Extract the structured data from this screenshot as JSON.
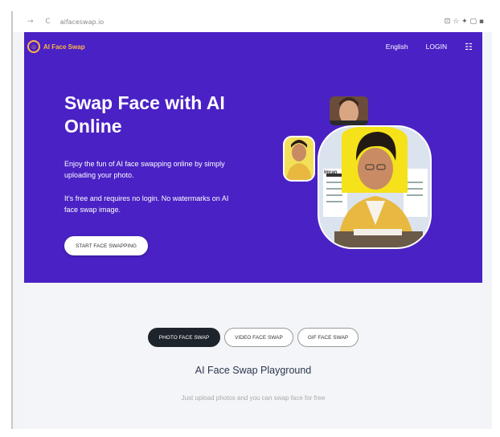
{
  "browser": {
    "nav_icons": "→ C",
    "url": "aifaceswap.io",
    "right_icons": "⊡ ☆ ✦ ▢ ▪"
  },
  "header": {
    "logo_text": "AI Face Swap",
    "language": "English",
    "login": "LOGIN",
    "menu_icon": "menu-icon"
  },
  "hero": {
    "title": "Swap Face with AI Online",
    "description_1": "Enjoy the fun of AI face swapping online by simply uploading your photo.",
    "description_2": "It's free and requires no login. No watermarks on AI face swap image.",
    "cta_label": "START FACE SWAPPING",
    "illustration_name_label": "Imran"
  },
  "playground": {
    "tabs": [
      {
        "label": "PHOTO FACE SWAP",
        "active": true
      },
      {
        "label": "VIDEO FACE SWAP",
        "active": false
      },
      {
        "label": "GIF FACE SWAP",
        "active": false
      }
    ],
    "title": "AI Face Swap Playground",
    "subtitle": "Just upload photos and you can swap face for free"
  },
  "colors": {
    "hero_bg": "#4a21c4",
    "logo": "#ffb347",
    "active_tab": "#1e242b",
    "snap_yellow": "#f5e21a",
    "arrow_orange": "#f7941d"
  }
}
